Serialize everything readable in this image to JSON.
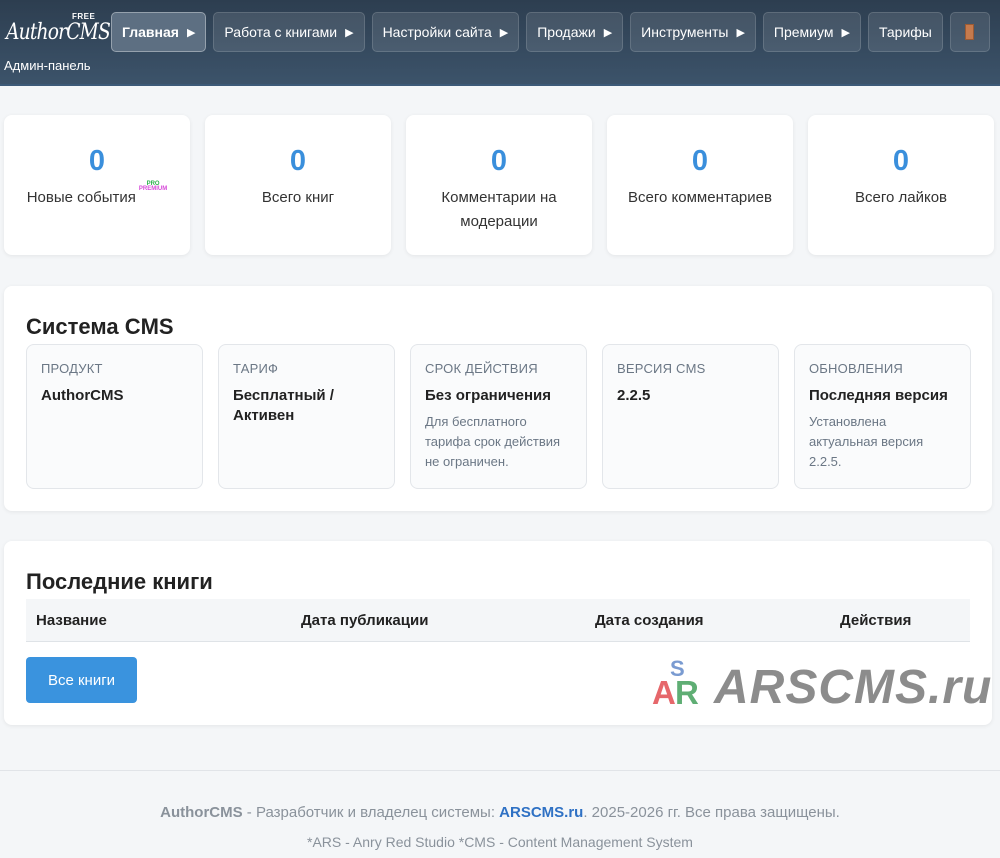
{
  "header": {
    "logo": {
      "free": "FREE",
      "name": "AuthorCMS",
      "subtitle": "Админ-панель"
    },
    "nav": [
      {
        "label": "Главная",
        "icon": "triangle-right-icon",
        "active": true
      },
      {
        "label": "Работа с книгами",
        "icon": "triangle-right-icon"
      },
      {
        "label": "Настройки сайта",
        "icon": "triangle-right-icon"
      },
      {
        "label": "Продажи",
        "icon": "triangle-right-icon"
      },
      {
        "label": "Инструменты",
        "icon": "triangle-right-icon"
      },
      {
        "label": "Премиум",
        "icon": "triangle-right-icon"
      },
      {
        "label": "Тарифы"
      }
    ],
    "extra_icon": "bookmark-icon"
  },
  "stats": [
    {
      "value": "0",
      "label": "Новые события",
      "badge": [
        "PRO",
        "PREMIUM"
      ]
    },
    {
      "value": "0",
      "label": "Всего книг"
    },
    {
      "value": "0",
      "label": "Комментарии на модерации"
    },
    {
      "value": "0",
      "label": "Всего комментариев"
    },
    {
      "value": "0",
      "label": "Всего лайков"
    }
  ],
  "system": {
    "title": "Система CMS",
    "items": [
      {
        "caption": "ПРОДУКТ",
        "value": "AuthorCMS",
        "note": ""
      },
      {
        "caption": "ТАРИФ",
        "value": "Бесплатный / Активен",
        "note": ""
      },
      {
        "caption": "СРОК ДЕЙСТВИЯ",
        "value": "Без ограничения",
        "note": "Для бесплатного тарифа срок действия не ограничен."
      },
      {
        "caption": "ВЕРСИЯ CMS",
        "value": "2.2.5",
        "note": ""
      },
      {
        "caption": "ОБНОВЛЕНИЯ",
        "value": "Последняя версия",
        "note": "Установлена актуальная версия 2.2.5."
      }
    ]
  },
  "books": {
    "title": "Последние книги",
    "columns": [
      "Название",
      "Дата публикации",
      "Дата создания",
      "Действия"
    ],
    "all_button": "Все книги"
  },
  "watermark": {
    "logo": [
      "A",
      "R",
      "S"
    ],
    "text": "ARSCMS.ru"
  },
  "footer": {
    "brand": "AuthorCMS",
    "text1": " - Разработчик и владелец системы: ",
    "link": "ARSCMS.ru",
    "text2": ". 2025-2026 гг. Все права защищены.",
    "line2": "*ARS - Anry Red Studio *CMS - Content Management System"
  },
  "colors": {
    "accent": "#3a8fdc",
    "header": "#2d3e50",
    "button": "#3a93de"
  }
}
